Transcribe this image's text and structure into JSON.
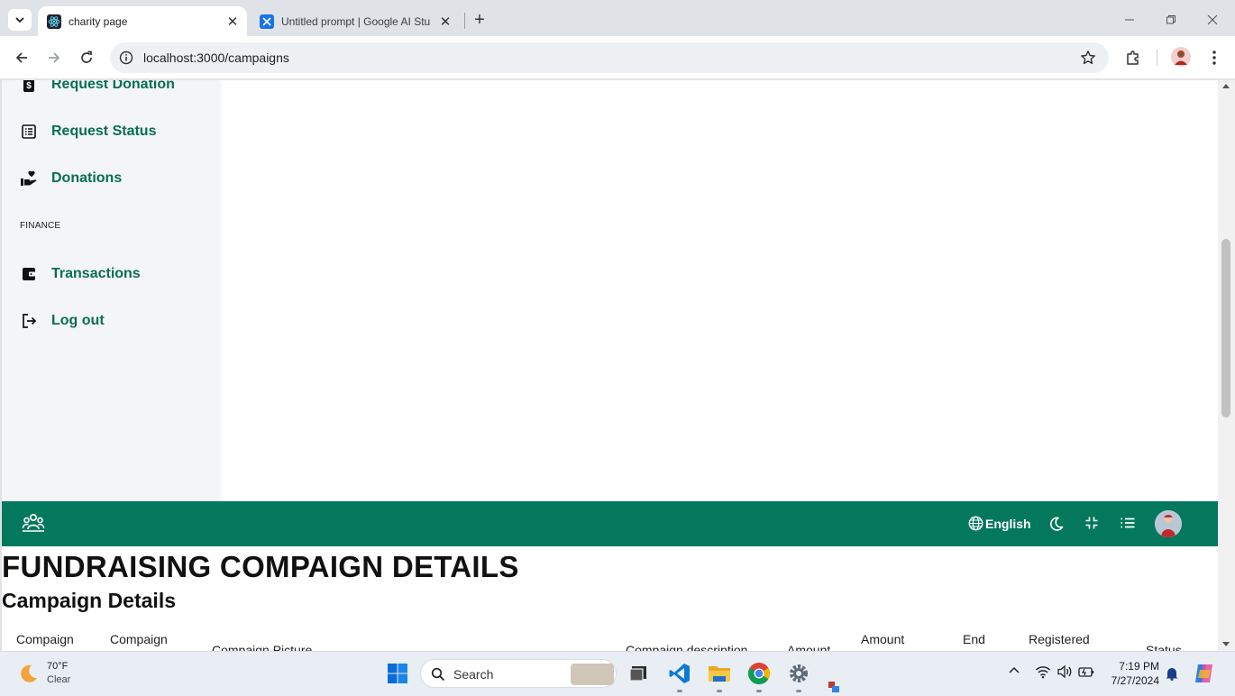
{
  "browser": {
    "tabs": [
      {
        "title": "charity page",
        "active": true
      },
      {
        "title": "Untitled prompt | Google AI Stu",
        "active": false
      }
    ],
    "url": "localhost:3000/campaigns"
  },
  "sidebar": {
    "items_top": [
      {
        "label": "Request Donation",
        "icon": "dollar-doc-icon"
      },
      {
        "label": "Request Status",
        "icon": "list-doc-icon"
      },
      {
        "label": "Donations",
        "icon": "hand-heart-icon"
      }
    ],
    "section_finance": "FINANCE",
    "items_bottom": [
      {
        "label": "Transactions",
        "icon": "wallet-icon"
      },
      {
        "label": "Log out",
        "icon": "logout-icon"
      }
    ]
  },
  "appbar": {
    "language": "English",
    "accent": "#04785d"
  },
  "main": {
    "title": "FUNDRAISING COMPAIGN DETAILS",
    "subtitle": "Campaign Details",
    "columns": [
      "Compaign",
      "Compaign",
      "Compaign Picture",
      "Compaign description",
      "Amount",
      "Amount",
      "End",
      "Registered",
      "Status"
    ]
  },
  "taskbar": {
    "weather_temp": "70°F",
    "weather_desc": "Clear",
    "search_placeholder": "Search",
    "time": "7:19 PM",
    "date": "7/27/2024"
  }
}
